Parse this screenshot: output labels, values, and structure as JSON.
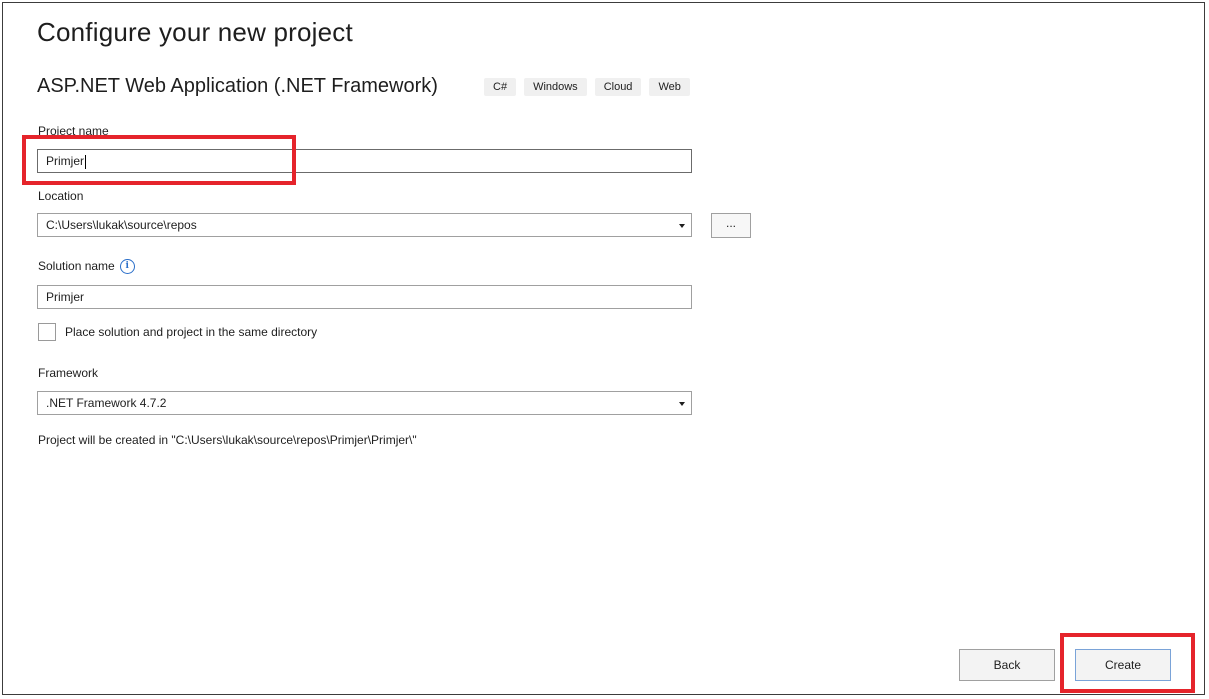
{
  "header": {
    "title": "Configure your new project",
    "template_name": "ASP.NET Web Application (.NET Framework)",
    "tags": [
      "C#",
      "Windows",
      "Cloud",
      "Web"
    ]
  },
  "form": {
    "project_name_label": "Project name",
    "project_name_value": "Primjer",
    "location_label": "Location",
    "location_value": "C:\\Users\\lukak\\source\\repos",
    "browse_label": "...",
    "solution_name_label": "Solution name",
    "solution_name_value": "Primjer",
    "same_directory_label": "Place solution and project in the same directory",
    "framework_label": "Framework",
    "framework_value": ".NET Framework 4.7.2",
    "created_in_text": "Project will be created in \"C:\\Users\\lukak\\source\\repos\\Primjer\\Primjer\\\""
  },
  "footer": {
    "back_label": "Back",
    "create_label": "Create"
  },
  "colors": {
    "highlight": "#e5242b",
    "info_icon": "#2b6fc9"
  }
}
